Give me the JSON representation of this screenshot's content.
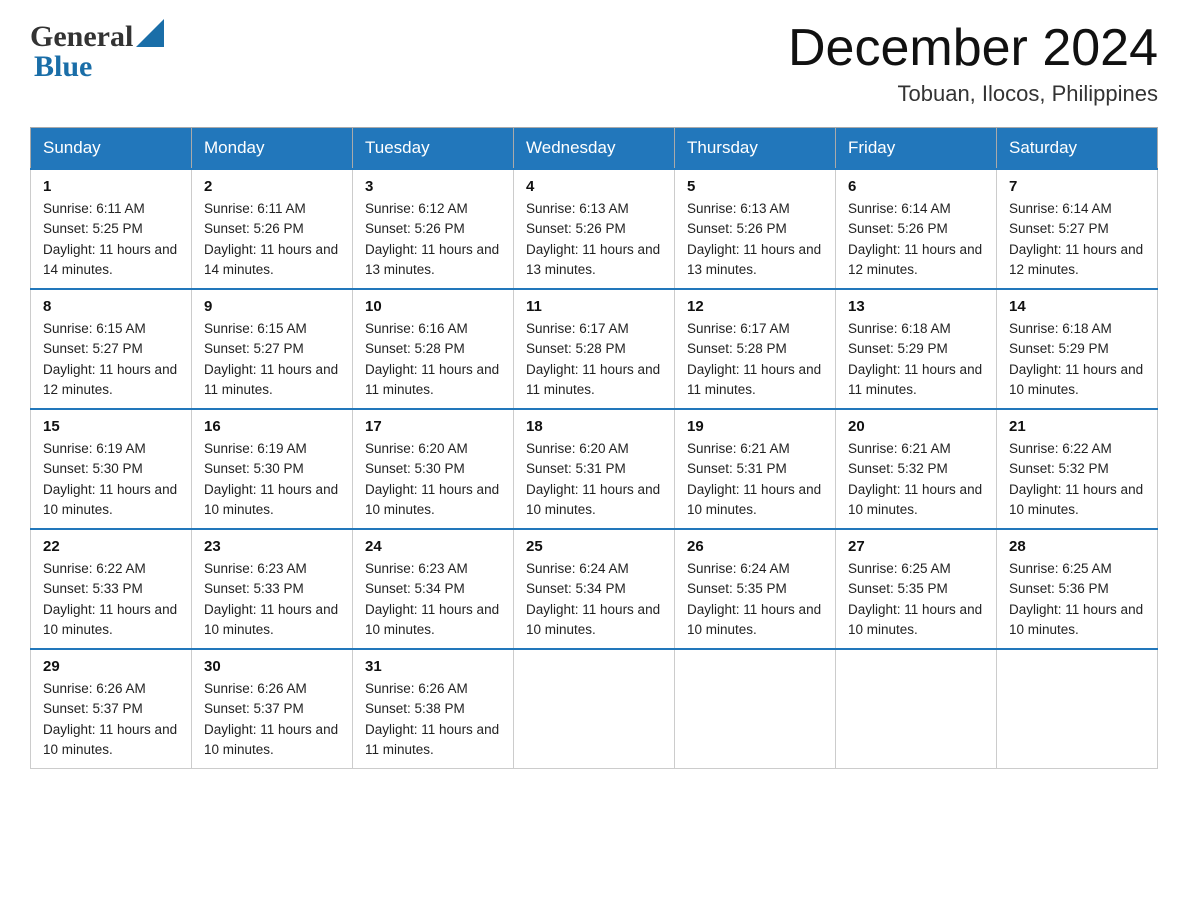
{
  "header": {
    "logo_general": "General",
    "logo_blue": "Blue",
    "month_title": "December 2024",
    "location": "Tobuan, Ilocos, Philippines"
  },
  "days_of_week": [
    "Sunday",
    "Monday",
    "Tuesday",
    "Wednesday",
    "Thursday",
    "Friday",
    "Saturday"
  ],
  "weeks": [
    [
      {
        "day": "1",
        "sunrise": "6:11 AM",
        "sunset": "5:25 PM",
        "daylight": "11 hours and 14 minutes."
      },
      {
        "day": "2",
        "sunrise": "6:11 AM",
        "sunset": "5:26 PM",
        "daylight": "11 hours and 14 minutes."
      },
      {
        "day": "3",
        "sunrise": "6:12 AM",
        "sunset": "5:26 PM",
        "daylight": "11 hours and 13 minutes."
      },
      {
        "day": "4",
        "sunrise": "6:13 AM",
        "sunset": "5:26 PM",
        "daylight": "11 hours and 13 minutes."
      },
      {
        "day": "5",
        "sunrise": "6:13 AM",
        "sunset": "5:26 PM",
        "daylight": "11 hours and 13 minutes."
      },
      {
        "day": "6",
        "sunrise": "6:14 AM",
        "sunset": "5:26 PM",
        "daylight": "11 hours and 12 minutes."
      },
      {
        "day": "7",
        "sunrise": "6:14 AM",
        "sunset": "5:27 PM",
        "daylight": "11 hours and 12 minutes."
      }
    ],
    [
      {
        "day": "8",
        "sunrise": "6:15 AM",
        "sunset": "5:27 PM",
        "daylight": "11 hours and 12 minutes."
      },
      {
        "day": "9",
        "sunrise": "6:15 AM",
        "sunset": "5:27 PM",
        "daylight": "11 hours and 11 minutes."
      },
      {
        "day": "10",
        "sunrise": "6:16 AM",
        "sunset": "5:28 PM",
        "daylight": "11 hours and 11 minutes."
      },
      {
        "day": "11",
        "sunrise": "6:17 AM",
        "sunset": "5:28 PM",
        "daylight": "11 hours and 11 minutes."
      },
      {
        "day": "12",
        "sunrise": "6:17 AM",
        "sunset": "5:28 PM",
        "daylight": "11 hours and 11 minutes."
      },
      {
        "day": "13",
        "sunrise": "6:18 AM",
        "sunset": "5:29 PM",
        "daylight": "11 hours and 11 minutes."
      },
      {
        "day": "14",
        "sunrise": "6:18 AM",
        "sunset": "5:29 PM",
        "daylight": "11 hours and 10 minutes."
      }
    ],
    [
      {
        "day": "15",
        "sunrise": "6:19 AM",
        "sunset": "5:30 PM",
        "daylight": "11 hours and 10 minutes."
      },
      {
        "day": "16",
        "sunrise": "6:19 AM",
        "sunset": "5:30 PM",
        "daylight": "11 hours and 10 minutes."
      },
      {
        "day": "17",
        "sunrise": "6:20 AM",
        "sunset": "5:30 PM",
        "daylight": "11 hours and 10 minutes."
      },
      {
        "day": "18",
        "sunrise": "6:20 AM",
        "sunset": "5:31 PM",
        "daylight": "11 hours and 10 minutes."
      },
      {
        "day": "19",
        "sunrise": "6:21 AM",
        "sunset": "5:31 PM",
        "daylight": "11 hours and 10 minutes."
      },
      {
        "day": "20",
        "sunrise": "6:21 AM",
        "sunset": "5:32 PM",
        "daylight": "11 hours and 10 minutes."
      },
      {
        "day": "21",
        "sunrise": "6:22 AM",
        "sunset": "5:32 PM",
        "daylight": "11 hours and 10 minutes."
      }
    ],
    [
      {
        "day": "22",
        "sunrise": "6:22 AM",
        "sunset": "5:33 PM",
        "daylight": "11 hours and 10 minutes."
      },
      {
        "day": "23",
        "sunrise": "6:23 AM",
        "sunset": "5:33 PM",
        "daylight": "11 hours and 10 minutes."
      },
      {
        "day": "24",
        "sunrise": "6:23 AM",
        "sunset": "5:34 PM",
        "daylight": "11 hours and 10 minutes."
      },
      {
        "day": "25",
        "sunrise": "6:24 AM",
        "sunset": "5:34 PM",
        "daylight": "11 hours and 10 minutes."
      },
      {
        "day": "26",
        "sunrise": "6:24 AM",
        "sunset": "5:35 PM",
        "daylight": "11 hours and 10 minutes."
      },
      {
        "day": "27",
        "sunrise": "6:25 AM",
        "sunset": "5:35 PM",
        "daylight": "11 hours and 10 minutes."
      },
      {
        "day": "28",
        "sunrise": "6:25 AM",
        "sunset": "5:36 PM",
        "daylight": "11 hours and 10 minutes."
      }
    ],
    [
      {
        "day": "29",
        "sunrise": "6:26 AM",
        "sunset": "5:37 PM",
        "daylight": "11 hours and 10 minutes."
      },
      {
        "day": "30",
        "sunrise": "6:26 AM",
        "sunset": "5:37 PM",
        "daylight": "11 hours and 10 minutes."
      },
      {
        "day": "31",
        "sunrise": "6:26 AM",
        "sunset": "5:38 PM",
        "daylight": "11 hours and 11 minutes."
      },
      null,
      null,
      null,
      null
    ]
  ],
  "labels": {
    "sunrise": "Sunrise:",
    "sunset": "Sunset:",
    "daylight": "Daylight:"
  }
}
